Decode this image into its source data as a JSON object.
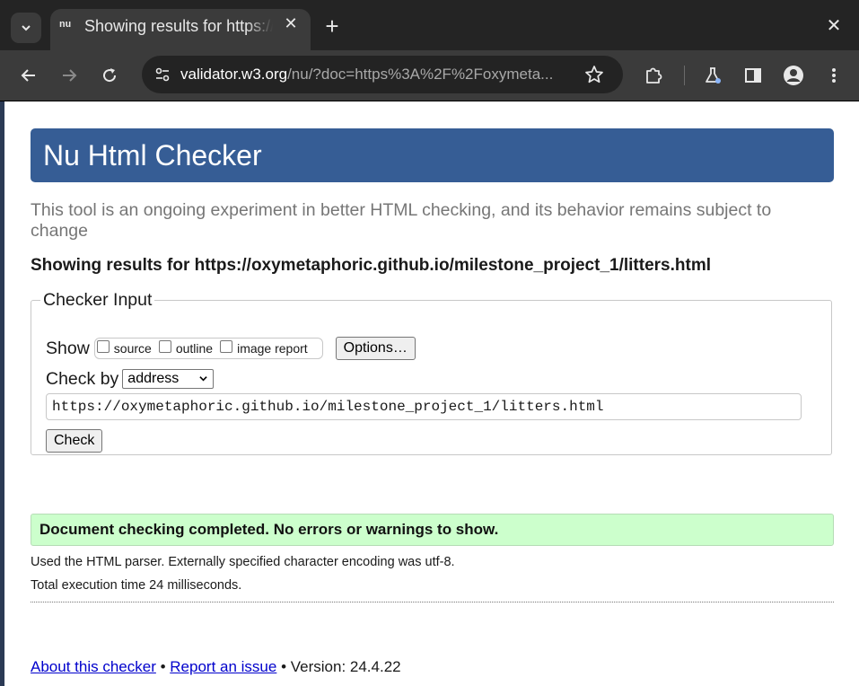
{
  "browser": {
    "tab": {
      "favicon_text": "nu",
      "title": "Showing results for https://oxymetaphoric.github.io/milestone_project_1/litters.html"
    },
    "omnibox": {
      "url_host": "validator.w3.org",
      "url_path": "/nu/?doc=https%3A%2F%2Foxymeta..."
    }
  },
  "page": {
    "title": "Nu Html Checker",
    "tagline": "This tool is an ongoing experiment in better HTML checking, and its behavior remains subject to change",
    "results_for": "Showing results for https://oxymetaphoric.github.io/milestone_project_1/litters.html",
    "checker": {
      "legend": "Checker Input",
      "show_label": "Show",
      "options": [
        {
          "label": "source",
          "checked": false
        },
        {
          "label": "outline",
          "checked": false
        },
        {
          "label": "image report",
          "checked": false
        }
      ],
      "options_button": "Options…",
      "check_by_label": "Check by",
      "check_by_value": "address",
      "address_value": "https://oxymetaphoric.github.io/milestone_project_1/litters.html",
      "check_button": "Check"
    },
    "success_message": "Document checking completed. No errors or warnings to show.",
    "details": {
      "parser": "Used the HTML parser. Externally specified character encoding was utf-8.",
      "time": "Total execution time 24 milliseconds."
    },
    "footer": {
      "about": "About this checker",
      "sep1": " • ",
      "report": "Report an issue",
      "version": " • Version: 24.4.22"
    }
  },
  "colors": {
    "header_bg": "#365d95",
    "success_bg": "#ccffcc",
    "link": "#0000cc"
  }
}
